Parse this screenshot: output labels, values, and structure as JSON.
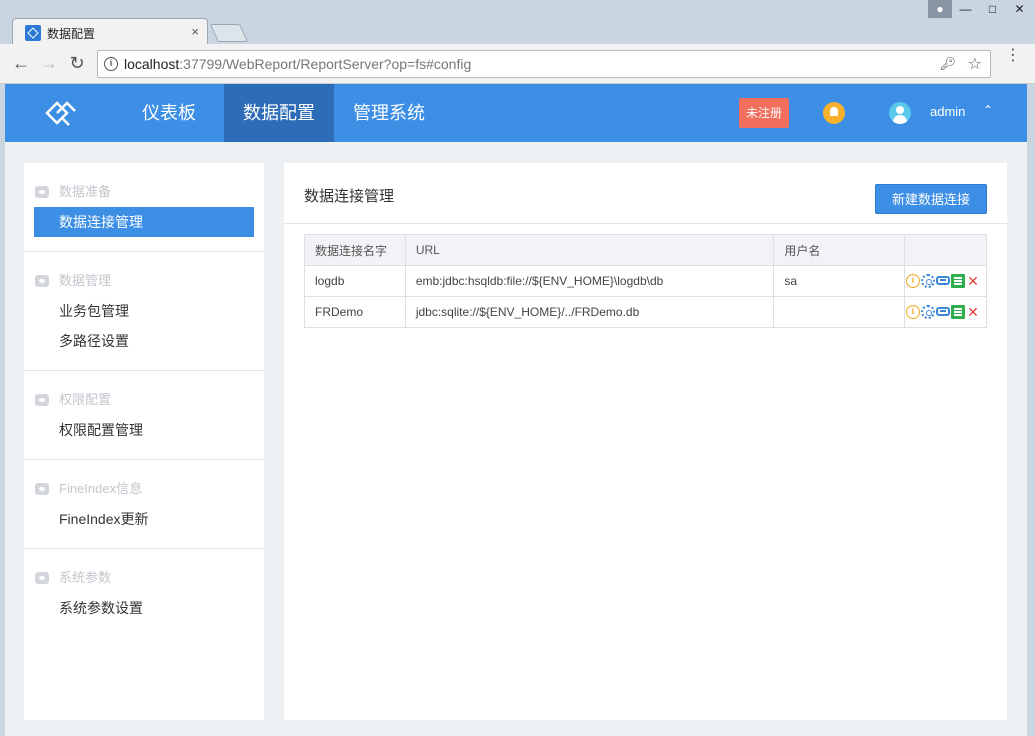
{
  "browser": {
    "tab_title": "数据配置",
    "tab_close": "×",
    "url_host": "localhost",
    "url_rest": ":37799/WebReport/ReportServer?op=fs#config"
  },
  "header": {
    "nav": [
      "仪表板",
      "数据配置",
      "管理系统"
    ],
    "active_nav": "数据配置",
    "unregistered_badge": "未注册",
    "user": "admin",
    "accent_color": "#3d8fe6"
  },
  "sidebar": {
    "groups": [
      {
        "title": "数据准备",
        "items": [
          "数据连接管理"
        ]
      },
      {
        "title": "数据管理",
        "items": [
          "业务包管理",
          "多路径设置"
        ]
      },
      {
        "title": "权限配置",
        "items": [
          "权限配置管理"
        ]
      },
      {
        "title": "FineIndex信息",
        "items": [
          "FineIndex更新"
        ]
      },
      {
        "title": "系统参数",
        "items": [
          "系统参数设置"
        ]
      }
    ],
    "active_item": "数据连接管理"
  },
  "main": {
    "title": "数据连接管理",
    "new_button": "新建数据连接",
    "table": {
      "headers": [
        "数据连接名字",
        "URL",
        "用户名",
        ""
      ],
      "rows": [
        {
          "name": "logdb",
          "url": "emb:jdbc:hsqldb:file://${ENV_HOME}\\logdb\\db",
          "user": "sa"
        },
        {
          "name": "FRDemo",
          "url": "jdbc:sqlite://${ENV_HOME}/../FRDemo.db",
          "user": ""
        }
      ],
      "row_actions": [
        "info-icon",
        "settings-icon",
        "link-icon",
        "copy-icon",
        "delete-icon"
      ]
    }
  }
}
